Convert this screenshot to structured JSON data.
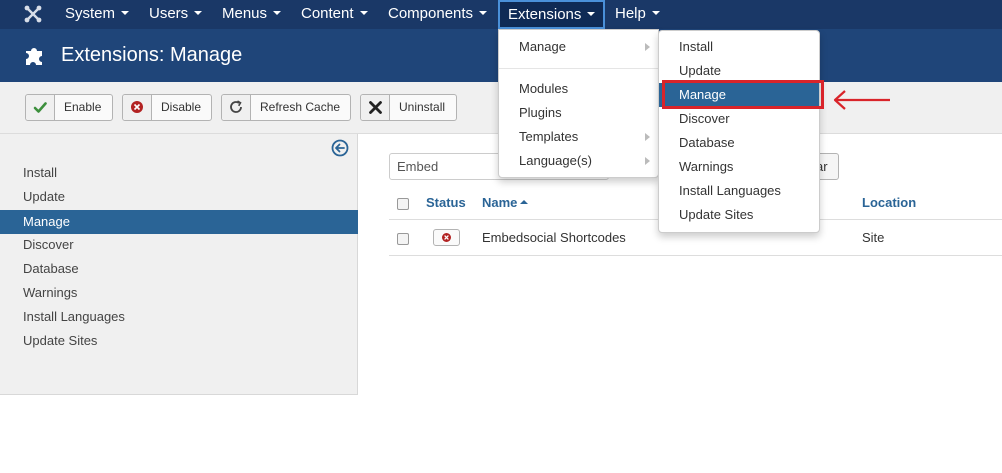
{
  "topnav": {
    "items": [
      {
        "label": "System"
      },
      {
        "label": "Users"
      },
      {
        "label": "Menus"
      },
      {
        "label": "Content"
      },
      {
        "label": "Components"
      },
      {
        "label": "Extensions"
      },
      {
        "label": "Help"
      }
    ]
  },
  "header": {
    "title": "Extensions: Manage"
  },
  "toolbar": {
    "enable": "Enable",
    "disable": "Disable",
    "refresh": "Refresh Cache",
    "uninstall": "Uninstall"
  },
  "sidebar": {
    "items": [
      {
        "label": "Install"
      },
      {
        "label": "Update"
      },
      {
        "label": "Manage"
      },
      {
        "label": "Discover"
      },
      {
        "label": "Database"
      },
      {
        "label": "Warnings"
      },
      {
        "label": "Install Languages"
      },
      {
        "label": "Update Sites"
      }
    ]
  },
  "filter": {
    "search_value": "Embed",
    "clear_label_visible": "ar"
  },
  "table": {
    "headers": {
      "status": "Status",
      "name": "Name",
      "location": "Location"
    },
    "rows": [
      {
        "name": "Embedsocial Shortcodes",
        "location": "Site"
      }
    ]
  },
  "extensions_menu": {
    "items": [
      {
        "label": "Manage"
      },
      {
        "label": "Modules"
      },
      {
        "label": "Plugins"
      },
      {
        "label": "Templates"
      },
      {
        "label": "Language(s)"
      }
    ]
  },
  "manage_submenu": {
    "items": [
      {
        "label": "Install"
      },
      {
        "label": "Update"
      },
      {
        "label": "Manage"
      },
      {
        "label": "Discover"
      },
      {
        "label": "Database"
      },
      {
        "label": "Warnings"
      },
      {
        "label": "Install Languages"
      },
      {
        "label": "Update Sites"
      }
    ]
  },
  "colors": {
    "topnav_bg": "#1a3867",
    "subheader_bg": "#1f4579",
    "active_item": "#2a6496",
    "highlight_annotation": "#d9242a"
  },
  "icons": [
    "joomla-logo-icon",
    "puzzle-icon",
    "check-icon",
    "disable-circle-icon",
    "refresh-icon",
    "close-x-icon",
    "collapse-arrow-icon",
    "sort-up-icon",
    "submenu-arrow-icon",
    "annotation-arrow-icon"
  ]
}
